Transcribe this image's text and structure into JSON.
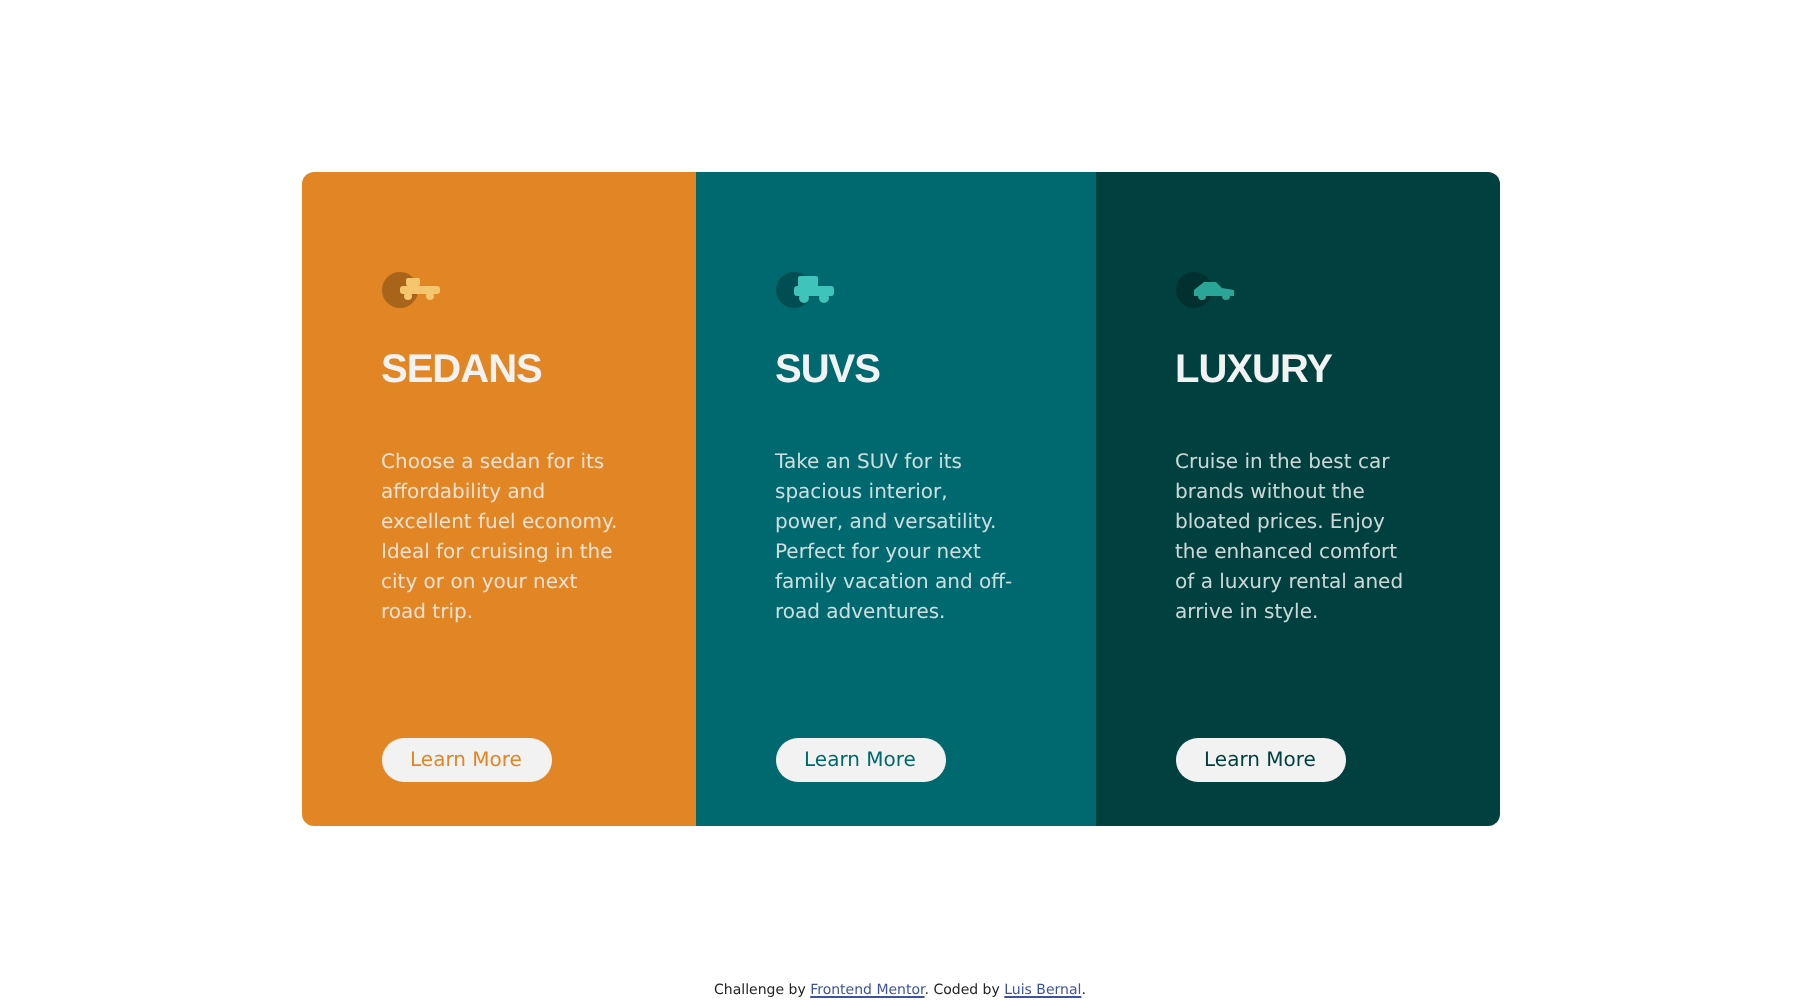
{
  "cards": [
    {
      "kind": "sedan",
      "color": "#e28625",
      "title": "SEDANS",
      "text": "Choose a sedan for its affordability and excellent fuel economy. Ideal for cruising in the city or on your next road trip.",
      "button": "Learn More"
    },
    {
      "kind": "suv",
      "color": "#006970",
      "title": "SUVS",
      "text": "Take an SUV for its spacious interior, power, and versatility. Perfect for your next family vacation and off-road adventures.",
      "button": "Learn More"
    },
    {
      "kind": "luxury",
      "color": "#004140",
      "title": "LUXURY",
      "text": "Cruise in the best car brands without the bloated prices. Enjoy the enhanced comfort of a luxury rental aned arrive in style.",
      "button": "Learn More"
    }
  ],
  "footer": [
    {
      "kind": "text",
      "text": "Challenge by "
    },
    {
      "kind": "link",
      "text": "Frontend Mentor"
    },
    {
      "kind": "text",
      "text": ". Coded by "
    },
    {
      "kind": "link",
      "text": "Luis Bernal"
    },
    {
      "kind": "text",
      "text": "."
    }
  ]
}
